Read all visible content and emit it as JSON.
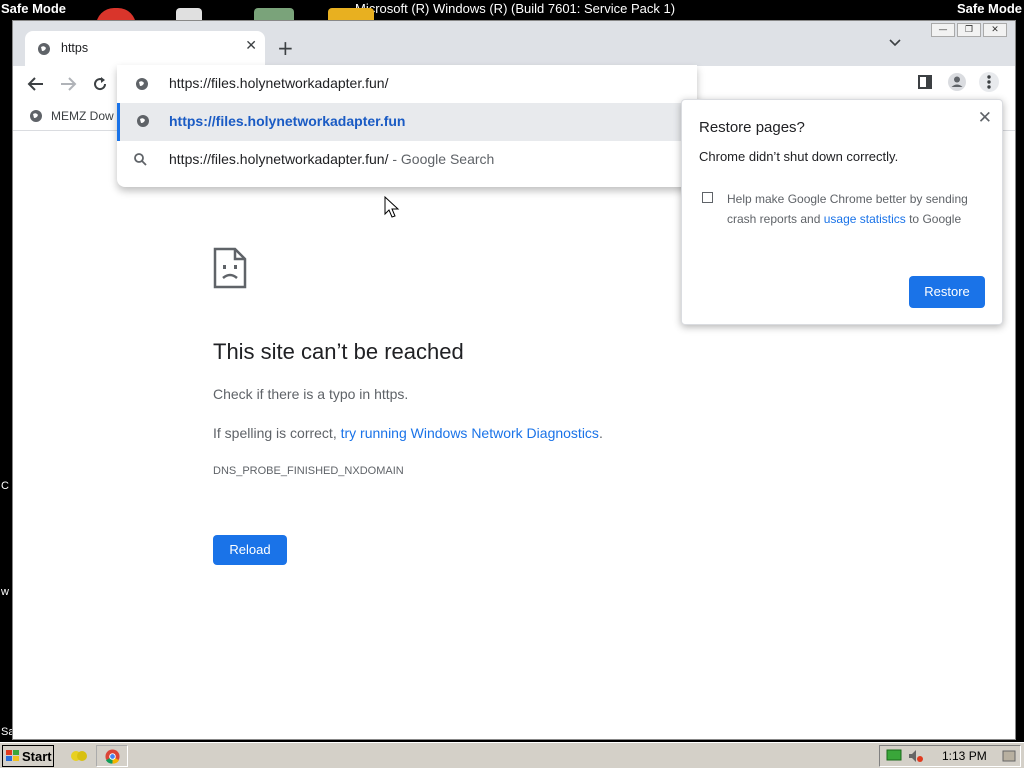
{
  "desktop": {
    "safe_mode_label": "Safe Mode",
    "window_title": "Microsoft (R) Windows (R) (Build 7601: Service Pack 1)",
    "side_letters": [
      "C",
      "w",
      "Sa"
    ]
  },
  "browser": {
    "tab_title": "https",
    "bookmark": "MEMZ Dow",
    "omnibox": {
      "typed_text": "https://files.holynetworkadapter.fun/",
      "suggestion_url": "https://files.holynetworkadapter.fun",
      "search_query": "https://files.holynetworkadapter.fun/",
      "search_suffix": " - Google Search"
    }
  },
  "error_page": {
    "title": "This site can’t be reached",
    "line1": "Check if there is a typo in https.",
    "line2_prefix": "If spelling is correct, ",
    "line2_link": "try running Windows Network Diagnostics",
    "line2_suffix": ".",
    "error_code": "DNS_PROBE_FINISHED_NXDOMAIN",
    "reload_label": "Reload"
  },
  "restore_dialog": {
    "title": "Restore pages?",
    "subtitle": "Chrome didn’t shut down correctly.",
    "checkbox_text_prefix": "Help make Google Chrome better by sending crash reports and ",
    "checkbox_link": "usage statistics",
    "checkbox_text_suffix": " to Google",
    "checkbox_checked": false,
    "restore_label": "Restore"
  },
  "taskbar": {
    "start_label": "Start",
    "clock": "1:13 PM"
  },
  "colors": {
    "accent": "#1a73e8",
    "text": "#202124",
    "secondary_text": "#5f6368"
  }
}
